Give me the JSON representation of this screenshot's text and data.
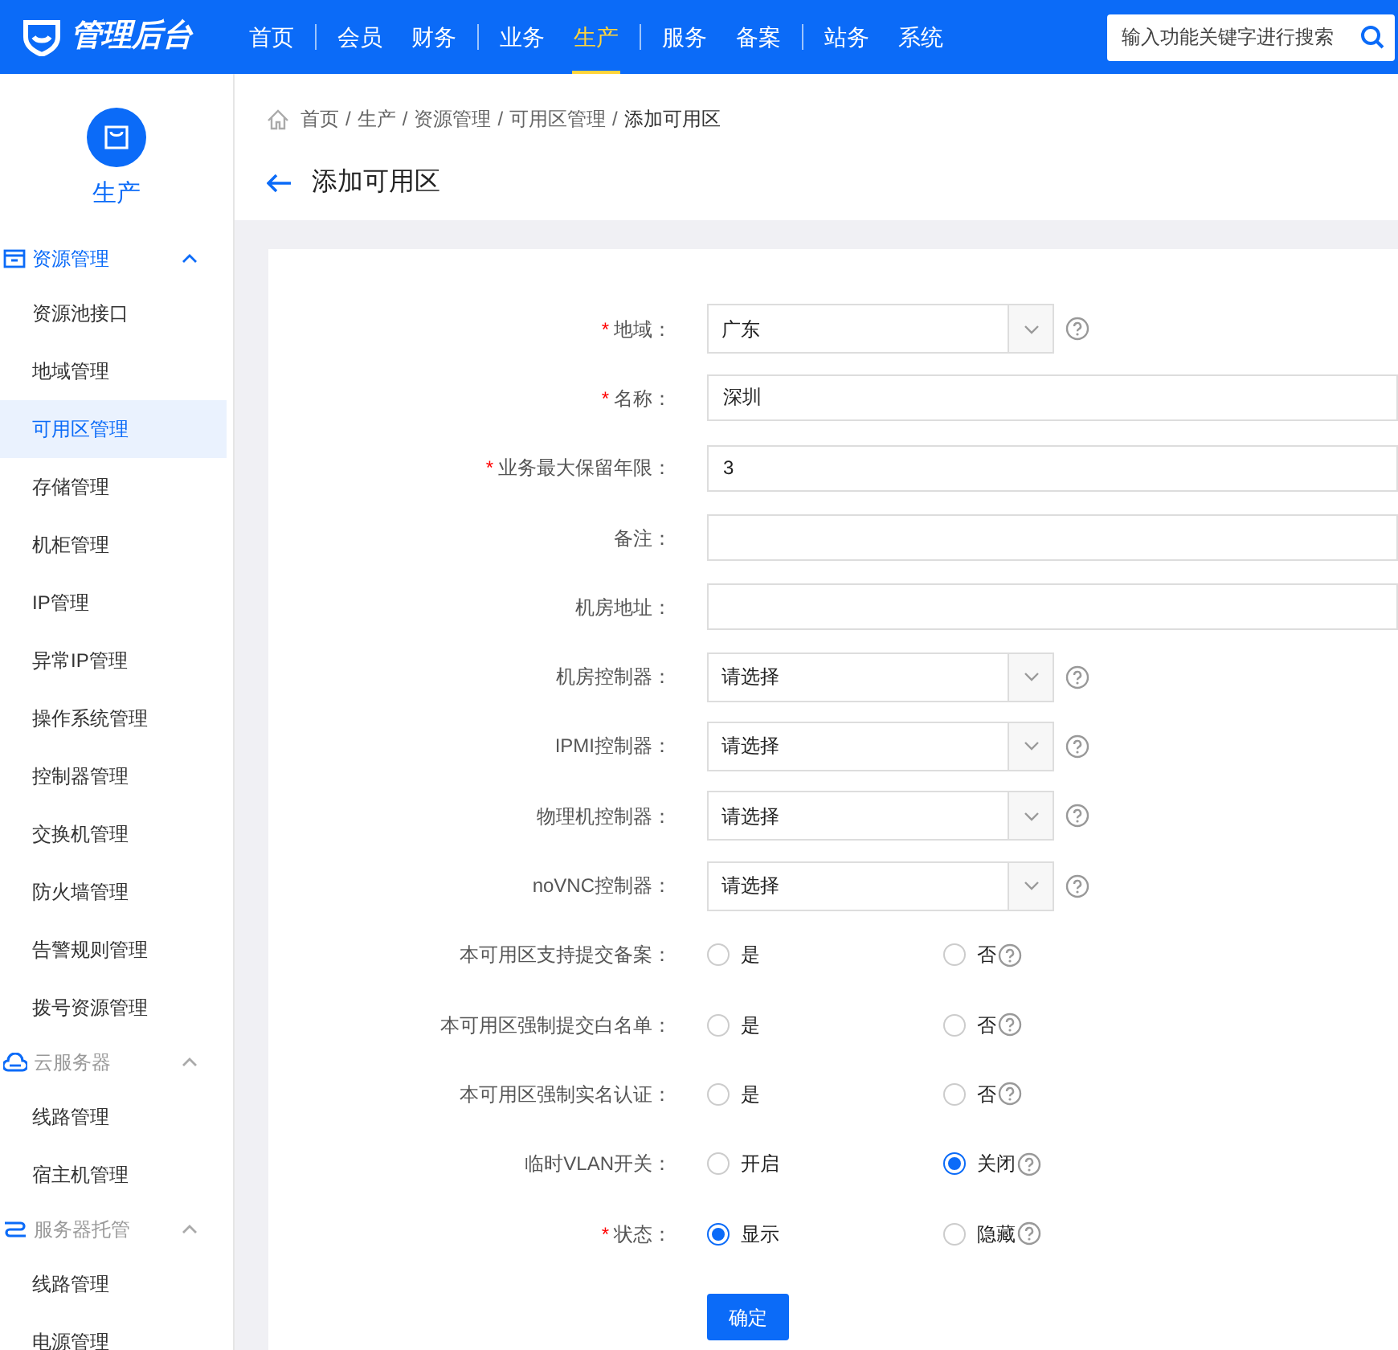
{
  "header": {
    "logo_text": "管理后台",
    "nav_groups": [
      [
        {
          "label": "首页",
          "selected": false
        }
      ],
      [
        {
          "label": "会员",
          "selected": false
        },
        {
          "label": "财务",
          "selected": false
        }
      ],
      [
        {
          "label": "业务",
          "selected": false
        },
        {
          "label": "生产",
          "selected": true
        }
      ],
      [
        {
          "label": "服务",
          "selected": false
        },
        {
          "label": "备案",
          "selected": false
        }
      ],
      [
        {
          "label": "站务",
          "selected": false
        },
        {
          "label": "系统",
          "selected": false
        }
      ]
    ],
    "search": {
      "placeholder": "输入功能关键字进行搜索"
    }
  },
  "sidebar": {
    "module": "生产",
    "groups": [
      {
        "title": "资源管理",
        "kind": "box",
        "active": true,
        "expanded": true,
        "items": [
          {
            "label": "资源池接口",
            "selected": false
          },
          {
            "label": "地域管理",
            "selected": false
          },
          {
            "label": "可用区管理",
            "selected": true
          },
          {
            "label": "存储管理",
            "selected": false
          },
          {
            "label": "机柜管理",
            "selected": false
          },
          {
            "label": "IP管理",
            "selected": false
          },
          {
            "label": "异常IP管理",
            "selected": false
          },
          {
            "label": "操作系统管理",
            "selected": false
          },
          {
            "label": "控制器管理",
            "selected": false
          },
          {
            "label": "交换机管理",
            "selected": false
          },
          {
            "label": "防火墙管理",
            "selected": false
          },
          {
            "label": "告警规则管理",
            "selected": false
          },
          {
            "label": "拨号资源管理",
            "selected": false
          }
        ]
      },
      {
        "title": "云服务器",
        "kind": "cloud",
        "active": false,
        "expanded": true,
        "items": [
          {
            "label": "线路管理",
            "selected": false
          },
          {
            "label": "宿主机管理",
            "selected": false
          }
        ]
      },
      {
        "title": "服务器托管",
        "kind": "link",
        "active": false,
        "expanded": true,
        "items": [
          {
            "label": "线路管理",
            "selected": false
          },
          {
            "label": "电源管理",
            "selected": false
          }
        ]
      }
    ]
  },
  "breadcrumb": [
    {
      "kind": "link",
      "text": "首页"
    },
    {
      "kind": "separator",
      "text": "/"
    },
    {
      "kind": "link",
      "text": "生产"
    },
    {
      "kind": "separator",
      "text": "/"
    },
    {
      "kind": "link",
      "text": "资源管理"
    },
    {
      "kind": "separator",
      "text": "/"
    },
    {
      "kind": "link",
      "text": "可用区管理"
    },
    {
      "kind": "separator",
      "text": "/"
    },
    {
      "kind": "current",
      "text": "添加可用区"
    }
  ],
  "page_title": "添加可用区",
  "form": {
    "fields": [
      {
        "kind": "select",
        "marker": "*",
        "label": "地域：",
        "value": "广东",
        "help": true
      },
      {
        "kind": "input",
        "marker": "*",
        "label": "名称：",
        "value": "深圳"
      },
      {
        "kind": "input",
        "marker": "*",
        "label": "业务最大保留年限：",
        "value": "3"
      },
      {
        "kind": "input",
        "label": "备注："
      },
      {
        "kind": "input",
        "label": "机房地址："
      },
      {
        "kind": "select",
        "label": "机房控制器：",
        "value": "请选择",
        "help": true
      },
      {
        "kind": "select",
        "label": "IPMI控制器：",
        "value": "请选择",
        "help": true
      },
      {
        "kind": "select",
        "label": "物理机控制器：",
        "value": "请选择",
        "help": true
      },
      {
        "kind": "select",
        "label": "noVNC控制器：",
        "value": "请选择",
        "help": true
      },
      {
        "kind": "radio",
        "label": "本可用区支持提交备案：",
        "help": true,
        "options": [
          {
            "label": "是",
            "selected": false
          },
          {
            "label": "否",
            "selected": false
          }
        ]
      },
      {
        "kind": "radio",
        "label": "本可用区强制提交白名单：",
        "help": true,
        "options": [
          {
            "label": "是",
            "selected": false
          },
          {
            "label": "否",
            "selected": false
          }
        ]
      },
      {
        "kind": "radio",
        "label": "本可用区强制实名认证：",
        "help": true,
        "options": [
          {
            "label": "是",
            "selected": false
          },
          {
            "label": "否",
            "selected": false
          }
        ]
      },
      {
        "kind": "radio",
        "label": "临时VLAN开关：",
        "help": true,
        "options": [
          {
            "label": "开启",
            "selected": false
          },
          {
            "label": "关闭",
            "selected": true
          }
        ]
      },
      {
        "kind": "radio",
        "marker": "*",
        "label": "状态：",
        "help": true,
        "options": [
          {
            "label": "显示",
            "selected": true
          },
          {
            "label": "隐藏",
            "selected": false
          }
        ]
      }
    ],
    "submit": "确定"
  }
}
